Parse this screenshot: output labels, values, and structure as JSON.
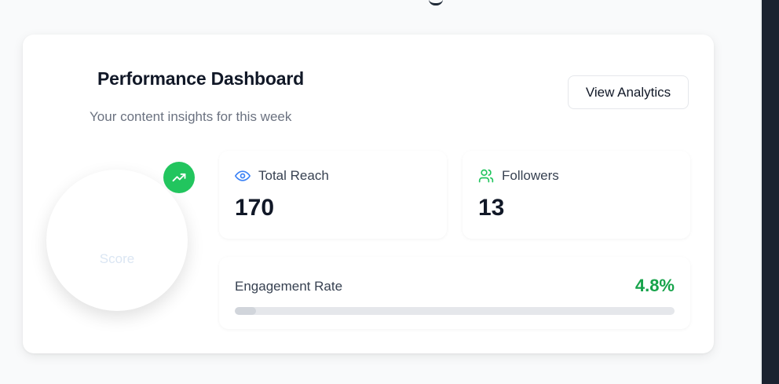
{
  "header": {
    "title": "Performance Dashboard",
    "subtitle": "Your content insights for this week",
    "view_button_label": "View Analytics"
  },
  "score": {
    "label": "Score",
    "trend_icon": "trending-up-icon"
  },
  "stats": {
    "reach": {
      "label": "Total Reach",
      "value": "170",
      "icon": "eye-icon",
      "icon_color": "#3b82f6"
    },
    "followers": {
      "label": "Followers",
      "value": "13",
      "icon": "users-icon",
      "icon_color": "#22c55e"
    }
  },
  "engagement": {
    "label": "Engagement Rate",
    "value": "4.8%",
    "progress_percent": 4.8,
    "value_color": "#16a34a"
  },
  "colors": {
    "accent_green": "#22c55e",
    "sidebar_dark": "#1b2230"
  }
}
